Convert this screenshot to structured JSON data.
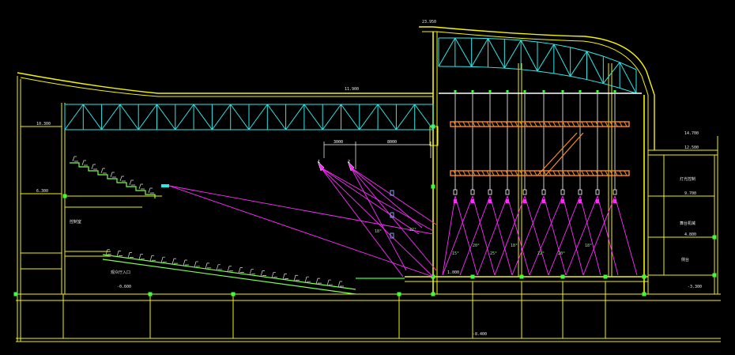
{
  "drawing": {
    "colors": {
      "background": "#000000",
      "structure": "#f5f500",
      "truss": "#2ee8e8",
      "sightline": "#ff2bff",
      "rigging": "#ff8c1a",
      "batten": "#ffffff",
      "seats": "#7cff4a",
      "dimension": "#ffffff"
    },
    "level_labels": {
      "roof_stage": "23.950",
      "roof_hall": "11.900",
      "left_upper": "10.300",
      "left_mid": "6.300",
      "right_top": "14.700",
      "right_a": "12.500",
      "right_b": "9.700",
      "right_c": "4.800",
      "stage_floor": "1.000",
      "hall_floor": "-0.600",
      "pit": "-3.300",
      "basement": "-8.400"
    },
    "room_labels": {
      "left_room": "控制室",
      "left_lower": "观众厅入口",
      "right_top": "灯光控制",
      "right_mid": "舞台机械",
      "right_low": "侧台"
    },
    "dimensions": {
      "d1": "3000",
      "d2": "8000"
    },
    "angle_labels": [
      "18°",
      "22°",
      "15°",
      "20°",
      "25°",
      "18°",
      "22°",
      "20°",
      "18°"
    ],
    "point_labels": {
      "p1": "1",
      "p2": "2"
    }
  }
}
